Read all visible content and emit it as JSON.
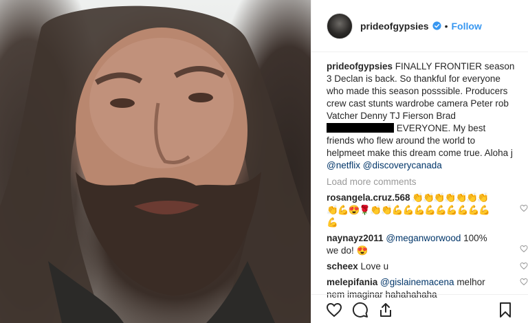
{
  "post": {
    "username": "prideofgypsies",
    "separator": "•",
    "follow_label": "Follow"
  },
  "caption": {
    "username": "prideofgypsies",
    "text_1": " FINALLY FRONTIER season 3 Declan is back. So thankful for everyone who made this season posssible. Producers crew cast stunts wardrobe camera Peter rob Vatcher Denny TJ Fierson Brad ",
    "text_2": " EVERYONE. My best friends who flew around the world to helpmeet make this dream come true. Aloha j ",
    "mention_1": "@netflix",
    "mention_2": "@discoverycanada"
  },
  "load_more": "Load more comments",
  "comments": [
    {
      "user": "rosangela.cruz.568",
      "text": " 👏👏👏👏👏👏👏👏💪😍🌹👏👏💪💪💪💪💪💪💪💪💪💪"
    },
    {
      "user": "naynayz2011",
      "mention": "@meganworwood",
      "text": " 100% we do! 😍"
    },
    {
      "user": "scheex",
      "text": " Love u"
    },
    {
      "user": "melepifania",
      "mention": "@gislainemacena",
      "text": " melhor nem imaginar hahahahaha"
    }
  ],
  "icons": [
    "verified-icon",
    "heart-icon",
    "comment-icon",
    "share-icon",
    "bookmark-icon"
  ],
  "colors": {
    "follow": "#3897f0",
    "verified": "#3897f0",
    "mention": "#003569",
    "muted": "#999999"
  }
}
